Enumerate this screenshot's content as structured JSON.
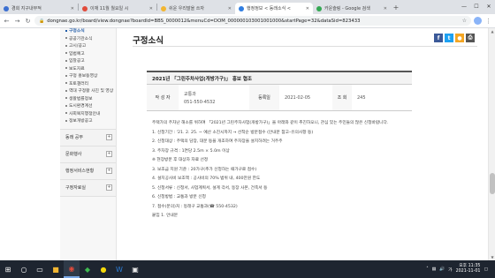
{
  "browser": {
    "tabs": [
      {
        "label": "경희 지구내부적",
        "fav_color": "#3b6fd1",
        "active": false
      },
      {
        "label": "이재 11월 월요일 시",
        "fav_color": "#e14b3b",
        "active": false
      },
      {
        "label": "쉬운 우리말을 쓰자",
        "fav_color": "#f2b632",
        "active": false
      },
      {
        "label": "행정정보 < 동래소식 <",
        "fav_color": "#2f7de1",
        "active": true
      },
      {
        "label": "카운슬링 - Google 검색",
        "fav_color": "#34a853",
        "active": false
      }
    ],
    "new_tab": "+",
    "url": "dongnae.go.kr/board/view.dongnae?boardId=BBS_0000012&menuCd=DOM_000000103001001000&startPage=32&dataSid=823433"
  },
  "sidebar": {
    "sub_items": [
      {
        "label": "구정소식",
        "active": true
      },
      {
        "label": "공공기관소식",
        "active": false
      },
      {
        "label": "고시/공고",
        "active": false
      },
      {
        "label": "입법예고",
        "active": false
      },
      {
        "label": "입찰공고",
        "active": false
      },
      {
        "label": "보도자료",
        "active": false
      },
      {
        "label": "구정 홍보동영상",
        "active": false
      },
      {
        "label": "포토갤러리",
        "active": false
      },
      {
        "label": "역대 구정활 사진 및 영상",
        "active": false
      },
      {
        "label": "생활법률정보",
        "active": false
      },
      {
        "label": "도시환경계선",
        "active": false
      },
      {
        "label": "사회복지행정안내",
        "active": false
      },
      {
        "label": "정보개방공고",
        "active": false
      }
    ],
    "categories": [
      {
        "label": "동래 공부"
      },
      {
        "label": "문화행사"
      },
      {
        "label": "행정서비스현황"
      },
      {
        "label": "구정자료실"
      }
    ]
  },
  "main": {
    "page_title": "구정소식",
    "post_title": "2021년 「그린주차사업(개방가구)」 홍보 협조",
    "meta": {
      "author_label": "작 성 자",
      "author_dept": "교통과",
      "author_phone": "051-550-4532",
      "date_label": "등록일",
      "date_value": "2021-02-05",
      "views_label": "조 회",
      "views_value": "245"
    },
    "body": [
      "주택가의 주차난 해소를 위하여 「2021년 그린주차사업(개방가구)」을 아래와 같이 추진하오니, 관심 있는 주민들의 많은 신청바랍니다.",
      "1. 신청기간 : '21. 2. 25. ~ 예산 소진시까지 → 선착순 방문접수 (안내문 참고–유의사항 등)",
      "2. 신청대상 : 주택의 담장, 대문 등을 개조하여 주차장을 설치하려는 거주주",
      "3. 주차장 규격 : 1면당 2.5m × 5.0m 이상",
      "※ 현장방문 후 대상자 자료 선정",
      "3. 보조금 지원 기준 : 20가구(추가 신청하는 때가구로 접수)",
      "4. 설치공사비 보조액 : 공사비의 70% 범위 내, 400만원 한도",
      "5. 신청서류 : 신청서, 사업계획서, 설계 각서, 동장 사본, 건축서 등",
      "6. 신청방법 : 교통과 방문 신청",
      "7. 접수(문의)처 : 동래구 교통과(☎ 550-4532)"
    ],
    "attachment": "붙임 1. 안내문"
  },
  "tray": {
    "time": "오후 11:35",
    "date": "2021-11-01"
  },
  "colors": {
    "accent": "#1f5aa6",
    "taskbar": "#1e2530"
  }
}
